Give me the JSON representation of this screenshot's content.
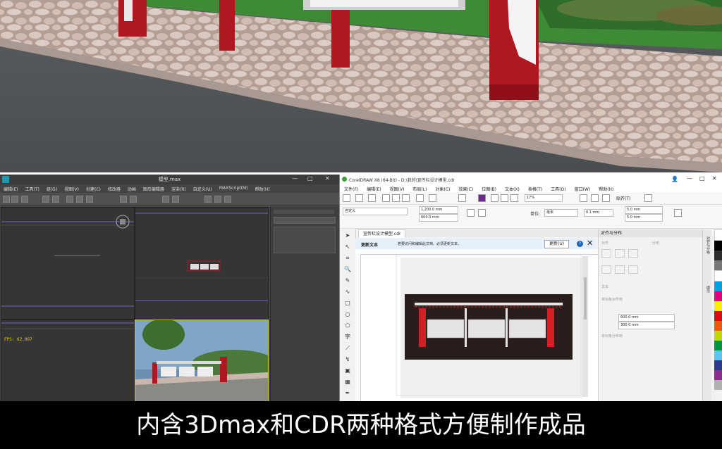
{
  "max": {
    "title": "模型.max",
    "menu": [
      "编辑(E)",
      "工具(T)",
      "组(G)",
      "视图(V)",
      "创建(C)",
      "修改器",
      "动画",
      "图形编辑器",
      "渲染(R)",
      "自定义(U)",
      "MAXScript(M)",
      "帮助(H)"
    ],
    "fps": "FPS: 62.067"
  },
  "cdr": {
    "title": "CorelDRAW X8 (64-Bit) - D:\\我的\\宣传栏设计模型.cdr",
    "menu": [
      "文件(F)",
      "编辑(E)",
      "视图(V)",
      "布局(L)",
      "对象(C)",
      "效果(C)",
      "位图(B)",
      "文本(X)",
      "表格(T)",
      "工具(O)",
      "窗口(W)",
      "帮助(H)"
    ],
    "zoom": "17%",
    "snap": "贴齐(T)",
    "preset": "自定义",
    "width": "1,200.0 mm",
    "height": "600.0 mm",
    "units_label": "单位:",
    "units": "毫米",
    "nudge": "0.1 mm",
    "dup_x": "5.0 mm",
    "dup_y": "5.0 mm",
    "doc_tab": "宣传栏设计模型.cdr",
    "notice_title": "更新文本",
    "notice_msg": "若要访问和编辑此文档，必须更新文本。",
    "notice_button": "更新(U)",
    "dock_title": "对齐与分布",
    "dock_sections": [
      "对齐",
      "分布",
      "文本",
      "将对象对齐到",
      "将对象分布到"
    ],
    "pos_x": "600.0 mm",
    "pos_y": "300.0 mm",
    "vtab_labels": [
      "对齐与分布",
      "提示"
    ]
  },
  "caption": "内含3Dmax和CDR两种格式方便制作成品"
}
